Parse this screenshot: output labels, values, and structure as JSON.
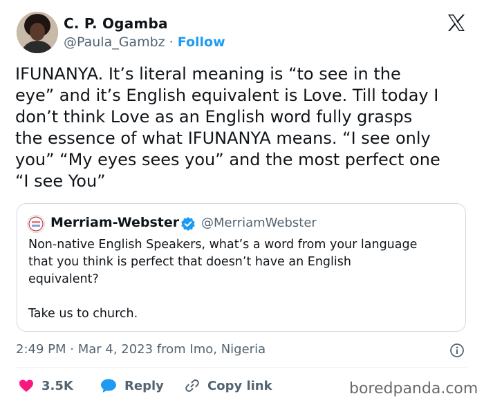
{
  "author": {
    "name": "C. P. Ogamba",
    "handle": "@Paula_Gambz",
    "separator": "·",
    "follow_label": "Follow"
  },
  "tweet_text": "IFUNANYA. It’s literal meaning is “to see in the\neye” and it’s English equivalent is Love. Till today I\ndon’t  think Love as an English word fully grasps\nthe essence of what IFUNANYA means. “I see only\nyou” “My eyes sees you” and the most perfect one\n“I see You”",
  "quoted_tweet": {
    "name": "Merriam-Webster",
    "handle": "@MerriamWebster",
    "text": "Non-native English Speakers, what’s a word from your language\nthat you think is perfect that doesn’t have an English\nequivalent?\n\nTake us to church."
  },
  "timestamp": "2:49 PM · Mar 4, 2023 from Imo, Nigeria",
  "actions": {
    "like_count": "3.5K",
    "reply_label": "Reply",
    "copy_link_label": "Copy link"
  },
  "watermark": "boredpanda.com",
  "icons": {
    "platform": "x-logo-icon",
    "like": "heart-icon",
    "reply": "speech-bubble-icon",
    "copy": "link-icon",
    "info": "info-icon",
    "verified": "verified-badge-icon"
  },
  "colors": {
    "follow": "#1d9bf0",
    "like": "#f91880",
    "reply": "#1d9bf0",
    "muted_text": "#536471",
    "verified": "#1d9bf0"
  }
}
